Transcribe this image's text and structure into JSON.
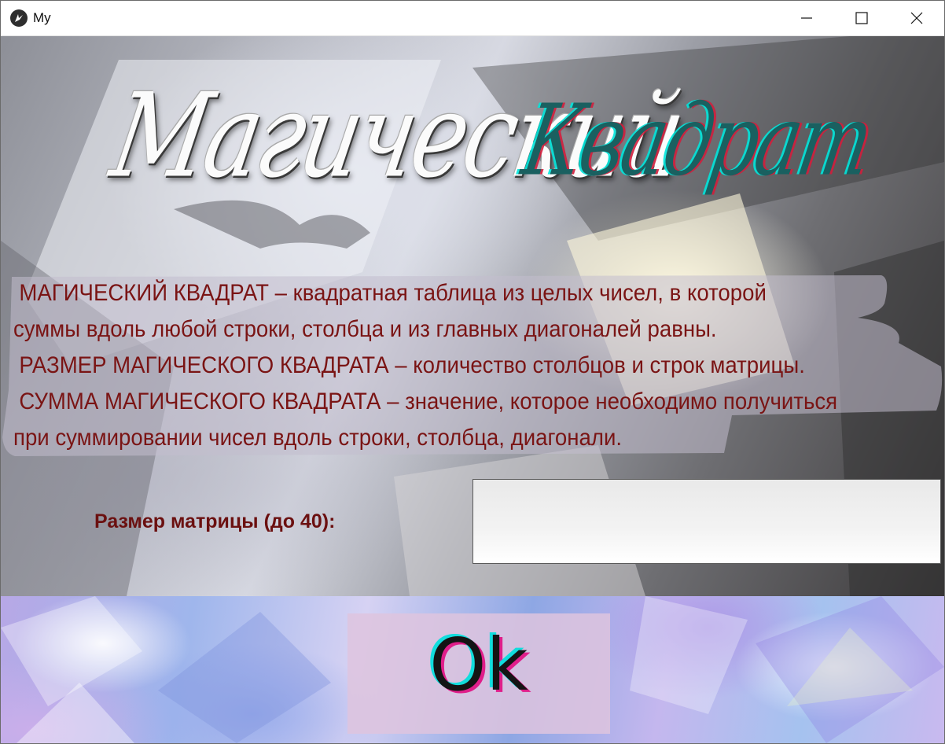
{
  "window": {
    "title": "My",
    "controls": {
      "minimize": "minimize",
      "maximize": "maximize",
      "close": "close"
    }
  },
  "header": {
    "title_word_1": "Магический",
    "title_word_2": "Квадрат"
  },
  "description": {
    "lines": [
      "МАГИЧЕСКИЙ КВАДРАТ – квадратная таблица из целых чисел, в которой",
      "суммы вдоль любой строки, столбца и из главных диагоналей равны.",
      "РАЗМЕР МАГИЧЕСКОГО КВАДРАТА – количество столбцов и строк матрицы.",
      "СУММА МАГИЧЕСКОГО КВАДРАТА – значение, которое необходимо получиться",
      "при суммировании чисел вдоль строки, столбца, диагонали."
    ]
  },
  "form": {
    "size_label": "Размер матрицы (до 40):",
    "size_value": ""
  },
  "actions": {
    "ok_label": "Ok"
  },
  "colors": {
    "label_text": "#6b1010",
    "description_text": "#7a1414",
    "ok_button_bg": "#dec4de",
    "title_accent": "#1a6060"
  },
  "icons": {
    "app": "kivy-logo-icon",
    "minimize": "minimize-icon",
    "maximize": "maximize-icon",
    "close": "close-icon"
  }
}
